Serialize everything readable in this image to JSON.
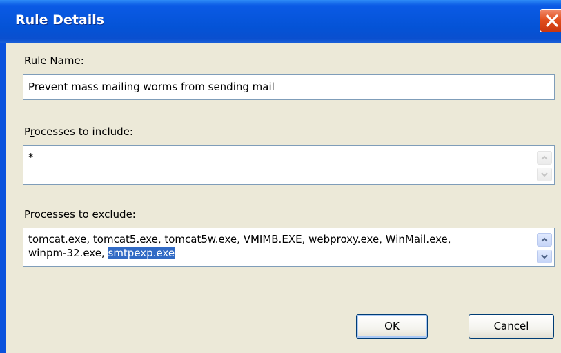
{
  "window": {
    "title": "Rule Details",
    "close_icon": "close-icon"
  },
  "rule_name": {
    "label_before": "Rule ",
    "label_accesskey": "N",
    "label_after": "ame:",
    "value": "Prevent mass mailing worms from sending mail"
  },
  "include": {
    "label_before": "P",
    "label_accesskey": "r",
    "label_after": "ocesses to include:",
    "value": "*"
  },
  "exclude": {
    "label_before": "",
    "label_accesskey": "P",
    "label_after": "rocesses to exclude:",
    "line1": "tomcat.exe, tomcat5.exe, tomcat5w.exe, VMIMB.EXE, webproxy.exe, WinMail.exe,",
    "line2_plain": "winpm-32.exe, ",
    "line2_selected": "smtpexp.exe"
  },
  "buttons": {
    "ok": "OK",
    "cancel": "Cancel"
  },
  "colors": {
    "titlebar": "#0453d6",
    "close_button": "#e2501f",
    "dialog_face": "#ece9d8",
    "selection": "#316ac5"
  }
}
